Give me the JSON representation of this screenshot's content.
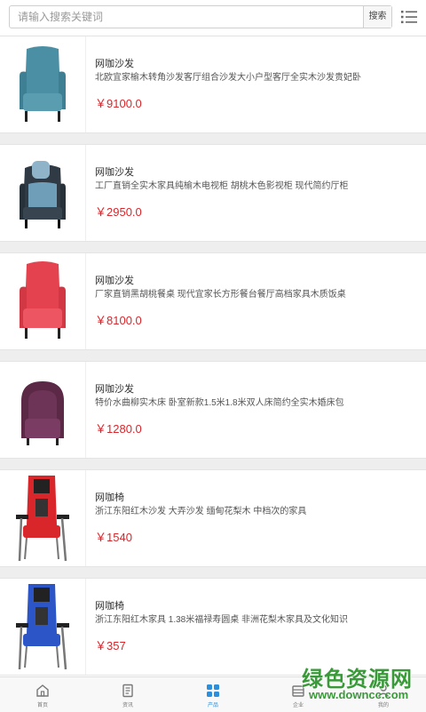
{
  "search": {
    "placeholder": "请输入搜索关键词",
    "button_label": "搜索"
  },
  "colors": {
    "price": "#d8262b",
    "nav_active": "#2b8fdc",
    "watermark": "#3a9a3a"
  },
  "products": [
    {
      "name": "网咖沙发",
      "desc": "北欧宜家榆木转角沙发客厅组合沙发大小户型客厅全实木沙发贵妃卧",
      "price": "￥9100.0"
    },
    {
      "name": "网咖沙发",
      "desc": "工厂直销全实木家具纯榆木电视柜 胡桃木色影视柜 现代简约厅柜",
      "price": "￥2950.0"
    },
    {
      "name": "网咖沙发",
      "desc": "厂家直销黑胡桃餐桌 现代宜家长方形餐台餐厅高档家具木质饭桌",
      "price": "￥8100.0"
    },
    {
      "name": "网咖沙发",
      "desc": "特价水曲柳实木床 卧室新款1.5米1.8米双人床简约全实木婚床包",
      "price": "￥1280.0"
    },
    {
      "name": "网咖椅",
      "desc": "浙江东阳红木沙发 大弄沙发 缅甸花梨木 中档次的家具",
      "price": "￥1540"
    },
    {
      "name": "网咖椅",
      "desc": "浙江东阳红木家具 1.38米福禄寿圆桌 非洲花梨木家具及文化知识",
      "price": "￥357"
    }
  ],
  "nav": {
    "home": "首页",
    "news": "资讯",
    "products": "产品",
    "company": "企业",
    "mine": "我的"
  },
  "watermark": {
    "title": "绿色资源网",
    "url": "www.downcc.com"
  }
}
